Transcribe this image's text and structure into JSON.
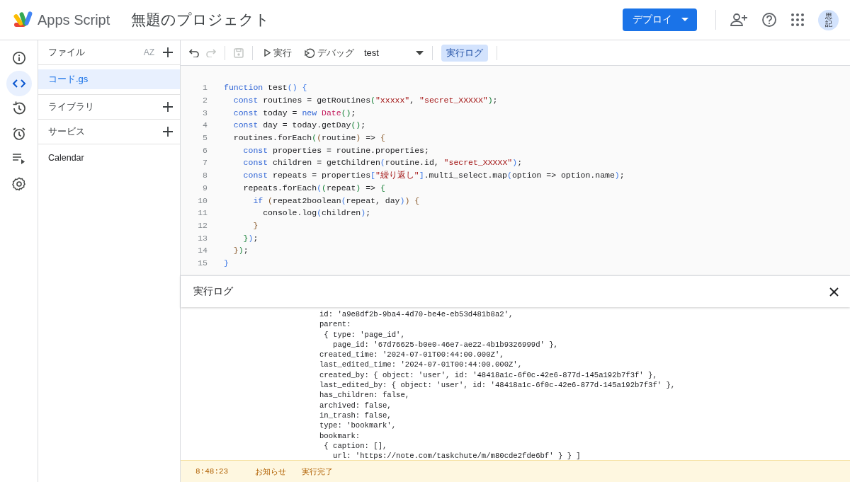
{
  "header": {
    "product": "Apps Script",
    "project_title": "無題のプロジェクト",
    "deploy_button": "デプロイ",
    "avatar_initials": "思記"
  },
  "rail": [
    {
      "kind": "info",
      "selected": false
    },
    {
      "kind": "code",
      "selected": true
    },
    {
      "kind": "history",
      "selected": false
    },
    {
      "kind": "alarm",
      "selected": false
    },
    {
      "kind": "executions",
      "selected": false
    },
    {
      "kind": "settings",
      "selected": false
    }
  ],
  "files_panel": {
    "title": "ファイル",
    "sort_label": "AZ",
    "files": [
      {
        "name": "コード.gs",
        "selected": true
      }
    ],
    "sections": [
      {
        "title": "ライブラリ"
      },
      {
        "title": "サービス"
      }
    ],
    "services": [
      {
        "name": "Calendar"
      }
    ]
  },
  "toolbar": {
    "undo_disabled": false,
    "redo_disabled": true,
    "save_disabled": true,
    "run_label": "実行",
    "debug_label": "デバッグ",
    "function_name": "test",
    "log_button": {
      "label": "実行ログ",
      "selected": true
    }
  },
  "editor": {
    "lines": [
      {
        "number": "1",
        "tokens": [
          {
            "kind": "keyword",
            "text": "function"
          },
          {
            "kind": "plain",
            "text": " test"
          },
          {
            "kind": "bracket1",
            "text": "() {"
          }
        ]
      },
      {
        "number": "2",
        "tokens": [
          {
            "kind": "keyword",
            "text": "  const"
          },
          {
            "kind": "plain",
            "text": " routines = getRoutines"
          },
          {
            "kind": "bracket2",
            "text": "("
          },
          {
            "kind": "string",
            "text": "\"xxxxx\""
          },
          {
            "kind": "plain",
            "text": ", "
          },
          {
            "kind": "string",
            "text": "\"secret_XXXXX\""
          },
          {
            "kind": "bracket2",
            "text": ")"
          },
          {
            "kind": "plain",
            "text": ";"
          }
        ]
      },
      {
        "number": "3",
        "tokens": [
          {
            "kind": "keyword",
            "text": "  const"
          },
          {
            "kind": "plain",
            "text": " today = "
          },
          {
            "kind": "keyword",
            "text": "new"
          },
          {
            "kind": "class",
            "text": " Date"
          },
          {
            "kind": "bracket2",
            "text": "()"
          },
          {
            "kind": "plain",
            "text": ";"
          }
        ]
      },
      {
        "number": "4",
        "tokens": [
          {
            "kind": "keyword",
            "text": "  const"
          },
          {
            "kind": "plain",
            "text": " day = today.getDay"
          },
          {
            "kind": "bracket2",
            "text": "()"
          },
          {
            "kind": "plain",
            "text": ";"
          }
        ]
      },
      {
        "number": "5",
        "tokens": [
          {
            "kind": "plain",
            "text": "  routines.forEach"
          },
          {
            "kind": "bracket2",
            "text": "("
          },
          {
            "kind": "bracket3",
            "text": "("
          },
          {
            "kind": "plain",
            "text": "routine"
          },
          {
            "kind": "bracket3",
            "text": ")"
          },
          {
            "kind": "plain",
            "text": " =>"
          },
          {
            "kind": "bracket3",
            "text": " {"
          }
        ]
      },
      {
        "number": "6",
        "tokens": [
          {
            "kind": "keyword",
            "text": "    const"
          },
          {
            "kind": "plain",
            "text": " properties = routine.properties;"
          }
        ]
      },
      {
        "number": "7",
        "tokens": [
          {
            "kind": "keyword",
            "text": "    const"
          },
          {
            "kind": "plain",
            "text": " children = getChildren"
          },
          {
            "kind": "bracket1",
            "text": "("
          },
          {
            "kind": "plain",
            "text": "routine.id, "
          },
          {
            "kind": "string",
            "text": "\"secret_XXXXX\""
          },
          {
            "kind": "bracket1",
            "text": ")"
          },
          {
            "kind": "plain",
            "text": ";"
          }
        ]
      },
      {
        "number": "8",
        "tokens": [
          {
            "kind": "keyword",
            "text": "    const"
          },
          {
            "kind": "plain",
            "text": " repeats = properties"
          },
          {
            "kind": "bracket1",
            "text": "["
          },
          {
            "kind": "string",
            "text": "\"繰り返し\""
          },
          {
            "kind": "bracket1",
            "text": "]"
          },
          {
            "kind": "plain",
            "text": ".multi_select.map"
          },
          {
            "kind": "bracket1",
            "text": "("
          },
          {
            "kind": "plain",
            "text": "option => option.name"
          },
          {
            "kind": "bracket1",
            "text": ")"
          },
          {
            "kind": "plain",
            "text": ";"
          }
        ]
      },
      {
        "number": "9",
        "tokens": [
          {
            "kind": "plain",
            "text": "    repeats.forEach"
          },
          {
            "kind": "bracket1",
            "text": "("
          },
          {
            "kind": "bracket2",
            "text": "("
          },
          {
            "kind": "plain",
            "text": "repeat"
          },
          {
            "kind": "bracket2",
            "text": ")"
          },
          {
            "kind": "plain",
            "text": " =>"
          },
          {
            "kind": "bracket2",
            "text": " {"
          }
        ]
      },
      {
        "number": "10",
        "tokens": [
          {
            "kind": "keyword",
            "text": "      if"
          },
          {
            "kind": "bracket3",
            "text": " ("
          },
          {
            "kind": "plain",
            "text": "repeat2boolean"
          },
          {
            "kind": "bracket1",
            "text": "("
          },
          {
            "kind": "plain",
            "text": "repeat, day"
          },
          {
            "kind": "bracket1",
            "text": ")"
          },
          {
            "kind": "bracket3",
            "text": ") {"
          }
        ]
      },
      {
        "number": "11",
        "tokens": [
          {
            "kind": "plain",
            "text": "        console.log"
          },
          {
            "kind": "bracket1",
            "text": "("
          },
          {
            "kind": "plain",
            "text": "children"
          },
          {
            "kind": "bracket1",
            "text": ")"
          },
          {
            "kind": "plain",
            "text": ";"
          }
        ]
      },
      {
        "number": "12",
        "tokens": [
          {
            "kind": "bracket3",
            "text": "      }"
          }
        ]
      },
      {
        "number": "13",
        "tokens": [
          {
            "kind": "bracket2",
            "text": "    }"
          },
          {
            "kind": "bracket1",
            "text": ")"
          },
          {
            "kind": "plain",
            "text": ";"
          }
        ]
      },
      {
        "number": "14",
        "tokens": [
          {
            "kind": "bracket3",
            "text": "  }"
          },
          {
            "kind": "bracket2",
            "text": ")"
          },
          {
            "kind": "plain",
            "text": ";"
          }
        ]
      },
      {
        "number": "15",
        "tokens": [
          {
            "kind": "bracket1",
            "text": "}"
          }
        ]
      }
    ]
  },
  "log": {
    "title": "実行ログ",
    "lines": [
      "id: 'a9e8df2b-9ba4-4d70-be4e-eb53d481b8a2',",
      "parent:",
      " { type: 'page_id',",
      "   page_id: '67d76625-b0e0-46e7-ae22-4b1b9326999d' },",
      "created_time: '2024-07-01T00:44:00.000Z',",
      "last_edited_time: '2024-07-01T00:44:00.000Z',",
      "created_by: { object: 'user', id: '48418a1c-6f0c-42e6-877d-145a192b7f3f' },",
      "last_edited_by: { object: 'user', id: '48418a1c-6f0c-42e6-877d-145a192b7f3f' },",
      "has_children: false,",
      "archived: false,",
      "in_trash: false,",
      "type: 'bookmark',",
      "bookmark:",
      " { caption: [],",
      "   url: 'https://note.com/taskchute/m/m80cde2fde6bf' } } ]"
    ],
    "status": {
      "time": "8:48:23",
      "level": "お知らせ",
      "message": "実行完了"
    }
  }
}
